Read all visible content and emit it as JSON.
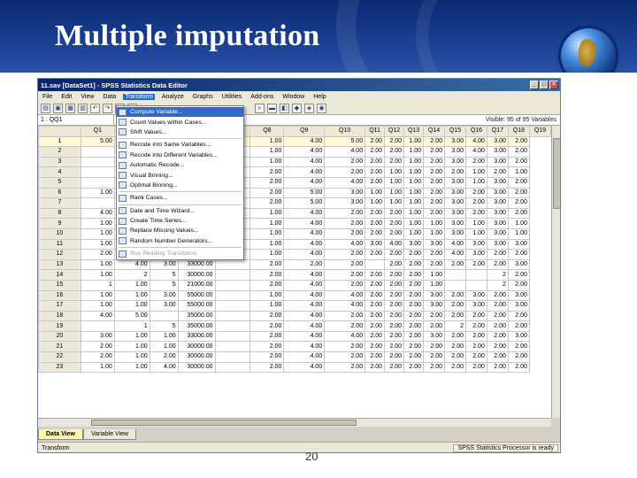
{
  "slide": {
    "title": "Multiple imputation",
    "page_number": "20"
  },
  "window": {
    "title": "11.sav [DataSet1] - SPSS Statistics Data Editor",
    "menus": [
      "File",
      "Edit",
      "View",
      "Data",
      "Transform",
      "Analyze",
      "Graphs",
      "Utilities",
      "Add-ons",
      "Window",
      "Help"
    ],
    "active_menu": "Transform",
    "cell_ref": "1 : QQ1",
    "visible_info": "Visible: 95 of 95 Variables",
    "tabs": [
      "Data View",
      "Variable View"
    ],
    "status_left": "Transform",
    "status_right": "SPSS Statistics Processor is ready"
  },
  "transform_menu": [
    {
      "label": "Compute Variable...",
      "highlight": true
    },
    {
      "label": "Count Values within Cases...",
      "highlight": false
    },
    {
      "label": "Shift Values...",
      "highlight": false
    },
    {
      "sep": true
    },
    {
      "label": "Recode into Same Variables...",
      "highlight": false
    },
    {
      "label": "Recode into Different Variables...",
      "highlight": false
    },
    {
      "label": "Automatic Recode...",
      "highlight": false
    },
    {
      "label": "Visual Binning...",
      "highlight": false
    },
    {
      "label": "Optimal Binning...",
      "highlight": false
    },
    {
      "sep": true
    },
    {
      "label": "Rank Cases...",
      "highlight": false
    },
    {
      "sep": true
    },
    {
      "label": "Date and Time Wizard...",
      "highlight": false
    },
    {
      "label": "Create Time Series...",
      "highlight": false
    },
    {
      "label": "Replace Missing Values...",
      "highlight": false
    },
    {
      "label": "Random Number Generators...",
      "highlight": false
    },
    {
      "sep": true
    },
    {
      "label": "Run Pending Transforms",
      "highlight": false,
      "disabled": true
    }
  ],
  "grid": {
    "columns": [
      "",
      "Q1",
      "",
      "",
      "",
      "",
      "Q8",
      "Q9",
      "Q10",
      "Q11",
      "Q12",
      "Q13",
      "Q14",
      "Q15",
      "Q16",
      "Q17",
      "Q18",
      "Q19"
    ],
    "rows": [
      [
        "1",
        "5.00",
        "",
        "",
        "",
        "",
        "1.00",
        "4.00",
        "5.00",
        "2.00",
        "2.00",
        "1.00",
        "2.00",
        "3.00",
        "4.00",
        "3.00",
        "2.00"
      ],
      [
        "2",
        "",
        "",
        "",
        "",
        "",
        "1.00",
        "4.00",
        "4.00",
        "2.00",
        "2.00",
        "1.00",
        "2.00",
        "3.00",
        "4.00",
        "3.00",
        "2.00"
      ],
      [
        "3",
        "",
        "",
        "",
        "",
        "",
        "1.00",
        "4.00",
        "2.00",
        "2.00",
        "2.00",
        "1.00",
        "2.00",
        "3.00",
        "2.00",
        "3.00",
        "2.00"
      ],
      [
        "4",
        "",
        "",
        "",
        "",
        "",
        "2.00",
        "4.00",
        "2.00",
        "2.00",
        "1.00",
        "1.00",
        "2.00",
        "2.00",
        "1.00",
        "2.00",
        "1.00"
      ],
      [
        "5",
        "",
        "",
        "",
        "",
        "",
        "2.00",
        "4.00",
        "4.00",
        "2.00",
        "1.00",
        "1.00",
        "2.00",
        "3.00",
        "1.00",
        "3.00",
        "2.00"
      ],
      [
        "6",
        "1.00",
        "",
        "",
        "",
        "",
        "2.00",
        "5.00",
        "3.00",
        "1.00",
        "1.00",
        "1.00",
        "2.00",
        "3.00",
        "2.00",
        "3.00",
        "2.00"
      ],
      [
        "7",
        "",
        "",
        "",
        "",
        "",
        "2.00",
        "5.00",
        "3.00",
        "1.00",
        "1.00",
        "1.00",
        "2.00",
        "3.00",
        "2.00",
        "3.00",
        "2.00"
      ],
      [
        "8",
        "4.00",
        "",
        "",
        "",
        "",
        "1.00",
        "4.00",
        "2.00",
        "2.00",
        "2.00",
        "1.00",
        "2.00",
        "3.00",
        "2.00",
        "3.00",
        "2.00"
      ],
      [
        "9",
        "1.00",
        "",
        "",
        "",
        "",
        "1.00",
        "4.00",
        "2.00",
        "2.00",
        "2.00",
        "1.00",
        "1.00",
        "3.00",
        "1.00",
        "3.00",
        "1.00"
      ],
      [
        "10",
        "1.00",
        "",
        "",
        "",
        "",
        "1.00",
        "4.00",
        "2.00",
        "2.00",
        "2.00",
        "1.00",
        "1.00",
        "3.00",
        "1.00",
        "3.00",
        "1.00"
      ],
      [
        "11",
        "1.00",
        "",
        "",
        "",
        "",
        "1.00",
        "4.00",
        "4.00",
        "3.00",
        "4.00",
        "3.00",
        "3.00",
        "4.00",
        "3.00",
        "3.00",
        "3.00"
      ],
      [
        "12",
        "2.00",
        "",
        "",
        "",
        "",
        "1.00",
        "4.00",
        "2.00",
        "2.00",
        "2.00",
        "2.00",
        "2.00",
        "4.00",
        "3.00",
        "2.00",
        "2.00"
      ],
      [
        "13",
        "1.00",
        "4.00",
        "3.00",
        "33000.00",
        "",
        "2.00",
        "2.00",
        "2.00",
        "",
        "2.00",
        "2.00",
        "2.00",
        "2.00",
        "2.00",
        "2.00",
        "3.00"
      ],
      [
        "14",
        "1.00",
        "2",
        "5",
        "30000.00",
        "",
        "2.00",
        "4.00",
        "2.00",
        "2.00",
        "2.00",
        "2.00",
        "1.00",
        "",
        "",
        "2",
        "2.00"
      ],
      [
        "15",
        "1",
        "1.00",
        "5",
        "21000.00",
        "",
        "2.00",
        "4.00",
        "2.00",
        "2.00",
        "2.00",
        "2.00",
        "1.00",
        "",
        "",
        "2",
        "2.00"
      ],
      [
        "16",
        "1.00",
        "1.00",
        "3.00",
        "55000.00",
        "",
        "1.00",
        "4.00",
        "4.00",
        "2.00",
        "2.00",
        "2.00",
        "3.00",
        "2.00",
        "3.00",
        "2.00",
        "3.00"
      ],
      [
        "17",
        "1.00",
        "1.00",
        "3.00",
        "55000.00",
        "",
        "1.00",
        "4.00",
        "4.00",
        "2.00",
        "2.00",
        "2.00",
        "3.00",
        "2.00",
        "3.00",
        "2.00",
        "3.00"
      ],
      [
        "18",
        "4.00",
        "5.00",
        "",
        "35000.00",
        "",
        "2.00",
        "4.00",
        "2.00",
        "2.00",
        "2.00",
        "2.00",
        "2.00",
        "2.00",
        "2.00",
        "2.00",
        "2.00"
      ],
      [
        "19",
        "",
        "1",
        "5",
        "35000.00",
        "",
        "2.00",
        "4.00",
        "2.00",
        "2.00",
        "2.00",
        "2.00",
        "2.00",
        "2",
        "2.00",
        "2.00",
        "2.00"
      ],
      [
        "20",
        "3.00",
        "1.00",
        "1.00",
        "33000.00",
        "",
        "2.00",
        "4.00",
        "4.00",
        "2.00",
        "2.00",
        "2.00",
        "3.00",
        "2.00",
        "2.00",
        "2.00",
        "3.00"
      ],
      [
        "21",
        "2.00",
        "1.00",
        "1.00",
        "30000.00",
        "",
        "2.00",
        "4.00",
        "2.00",
        "2.00",
        "2.00",
        "2.00",
        "2.00",
        "2.00",
        "2.00",
        "2.00",
        "2.00"
      ],
      [
        "22",
        "2.00",
        "1.00",
        "2.00",
        "30000.00",
        "",
        "2.00",
        "4.00",
        "2.00",
        "2.00",
        "2.00",
        "2.00",
        "2.00",
        "2.00",
        "2.00",
        "2.00",
        "2.00"
      ],
      [
        "23",
        "1.00",
        "1.00",
        "4.00",
        "30000.00",
        "",
        "2.00",
        "4.00",
        "2.00",
        "2.00",
        "2.00",
        "2.00",
        "2.00",
        "2.00",
        "2.00",
        "2.00",
        "2.00"
      ]
    ]
  }
}
